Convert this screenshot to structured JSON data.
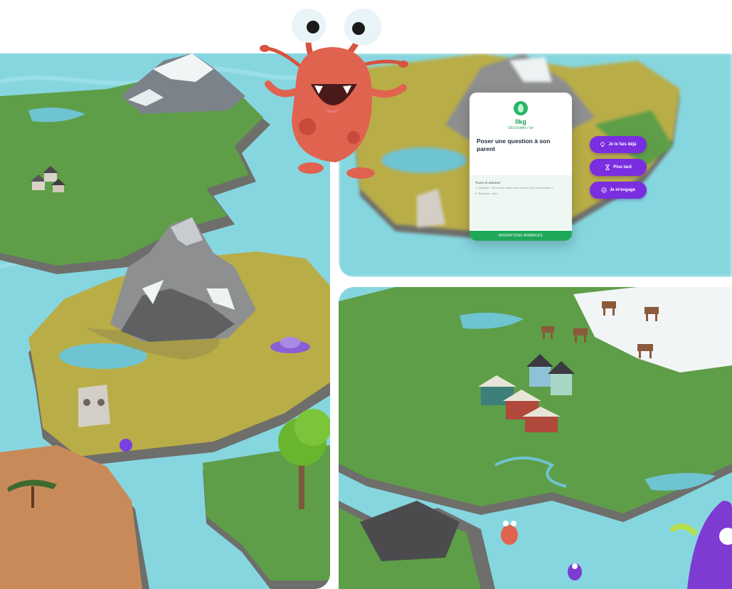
{
  "challenge_card": {
    "co2_value": "0kg",
    "co2_caption": "GES Évités / an",
    "question": "Poser une question à son parent",
    "tips_title": "Trucs et astuces",
    "tips": [
      "1. Question : De quelle couleur est la peau d'un ours polaire ?",
      "2. Reponse: noire."
    ],
    "cta_label": "MIGRATIONS ANIMALES"
  },
  "actions": [
    {
      "label": "Je le fais déjà",
      "icon": "lightbulb-icon"
    },
    {
      "label": "Plus tard",
      "icon": "hourglass-icon"
    },
    {
      "label": "Je m'engage",
      "icon": "check-circle-icon"
    }
  ],
  "colors": {
    "water": "#7fd3df",
    "grass": "#5f9f49",
    "dry_grass": "#b8ab47",
    "rock": "#8c9193",
    "snow": "#f3f6f7",
    "sand": "#c98a5a",
    "purple": "#7b2ee0",
    "green": "#1fa85a",
    "monster_red": "#e0634f"
  }
}
